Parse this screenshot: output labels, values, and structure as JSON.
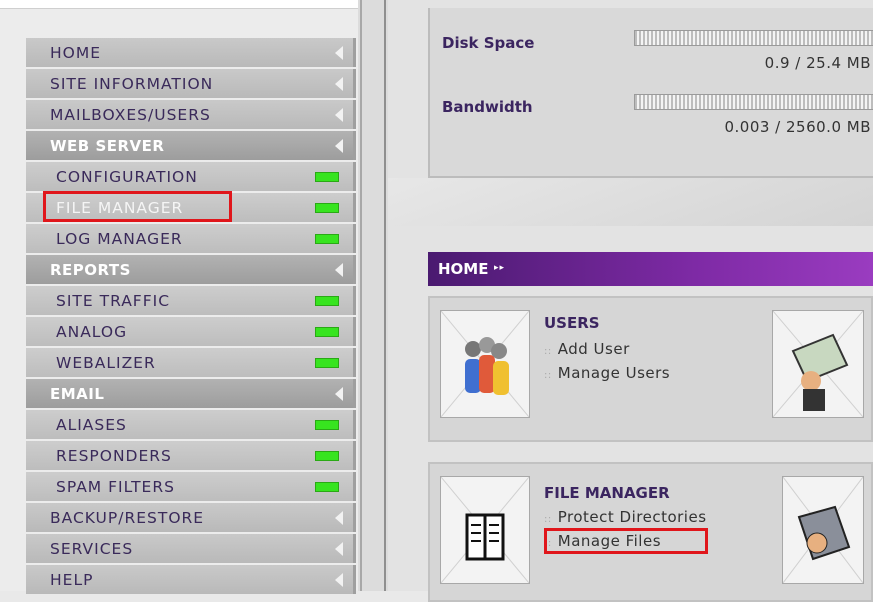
{
  "sidebar": {
    "items": [
      {
        "label": "HOME",
        "kind": "main"
      },
      {
        "label": "SITE INFORMATION",
        "kind": "main"
      },
      {
        "label": "MAILBOXES/USERS",
        "kind": "main"
      },
      {
        "label": "WEB SERVER",
        "kind": "cat"
      },
      {
        "label": "CONFIGURATION",
        "kind": "sub"
      },
      {
        "label": "FILE MANAGER",
        "kind": "sub",
        "highlighted": true
      },
      {
        "label": "LOG MANAGER",
        "kind": "sub"
      },
      {
        "label": "REPORTS",
        "kind": "cat"
      },
      {
        "label": "SITE TRAFFIC",
        "kind": "sub"
      },
      {
        "label": "ANALOG",
        "kind": "sub"
      },
      {
        "label": "WEBALIZER",
        "kind": "sub"
      },
      {
        "label": "EMAIL",
        "kind": "cat"
      },
      {
        "label": "ALIASES",
        "kind": "sub"
      },
      {
        "label": "RESPONDERS",
        "kind": "sub"
      },
      {
        "label": "SPAM FILTERS",
        "kind": "sub"
      },
      {
        "label": "BACKUP/RESTORE",
        "kind": "main"
      },
      {
        "label": "SERVICES",
        "kind": "main"
      },
      {
        "label": "HELP",
        "kind": "main"
      }
    ]
  },
  "stats": {
    "disk_label": "Disk Space",
    "disk_value": "0.9 / 25.4 MB",
    "disk_fraction": 0.035,
    "bandwidth_label": "Bandwidth",
    "bandwidth_value": "0.003 / 2560.0 MB",
    "bandwidth_fraction": 0.0
  },
  "home_bar": {
    "title": "HOME",
    "arrows": "▸▸"
  },
  "users_panel": {
    "title": "USERS",
    "links": [
      "Add User",
      "Manage Users"
    ]
  },
  "file_manager_panel": {
    "title": "FILE MANAGER",
    "links": [
      "Protect Directories",
      "Manage Files"
    ]
  },
  "colors": {
    "accent": "#5a2380",
    "led": "#37e41f",
    "highlight": "#e0161b"
  }
}
